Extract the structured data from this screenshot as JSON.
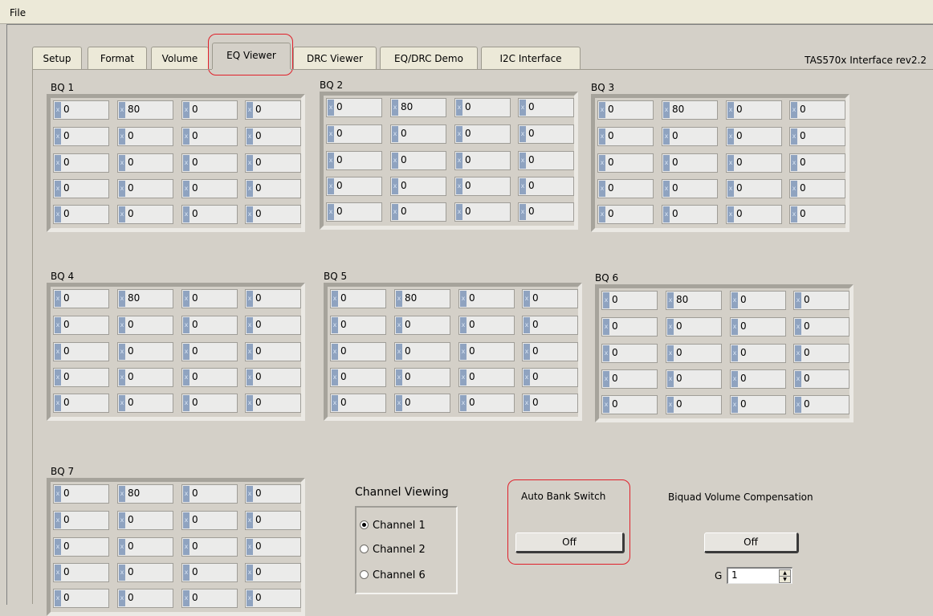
{
  "menu": {
    "file": "File"
  },
  "tabs": [
    {
      "label": "Setup"
    },
    {
      "label": "Format"
    },
    {
      "label": "Volume"
    },
    {
      "label": "EQ Viewer",
      "active": true
    },
    {
      "label": "DRC Viewer"
    },
    {
      "label": "EQ/DRC Demo"
    },
    {
      "label": "I2C Interface"
    }
  ],
  "revision": "TAS570x Interface rev2.2",
  "biquads": [
    {
      "label": "BQ 1",
      "rows": [
        [
          "0",
          "80",
          "0",
          "0"
        ],
        [
          "0",
          "0",
          "0",
          "0"
        ],
        [
          "0",
          "0",
          "0",
          "0"
        ],
        [
          "0",
          "0",
          "0",
          "0"
        ],
        [
          "0",
          "0",
          "0",
          "0"
        ]
      ]
    },
    {
      "label": "BQ 2",
      "rows": [
        [
          "0",
          "80",
          "0",
          "0"
        ],
        [
          "0",
          "0",
          "0",
          "0"
        ],
        [
          "0",
          "0",
          "0",
          "0"
        ],
        [
          "0",
          "0",
          "0",
          "0"
        ],
        [
          "0",
          "0",
          "0",
          "0"
        ]
      ]
    },
    {
      "label": "BQ 3",
      "rows": [
        [
          "0",
          "80",
          "0",
          "0"
        ],
        [
          "0",
          "0",
          "0",
          "0"
        ],
        [
          "0",
          "0",
          "0",
          "0"
        ],
        [
          "0",
          "0",
          "0",
          "0"
        ],
        [
          "0",
          "0",
          "0",
          "0"
        ]
      ]
    },
    {
      "label": "BQ 4",
      "rows": [
        [
          "0",
          "80",
          "0",
          "0"
        ],
        [
          "0",
          "0",
          "0",
          "0"
        ],
        [
          "0",
          "0",
          "0",
          "0"
        ],
        [
          "0",
          "0",
          "0",
          "0"
        ],
        [
          "0",
          "0",
          "0",
          "0"
        ]
      ]
    },
    {
      "label": "BQ 5",
      "rows": [
        [
          "0",
          "80",
          "0",
          "0"
        ],
        [
          "0",
          "0",
          "0",
          "0"
        ],
        [
          "0",
          "0",
          "0",
          "0"
        ],
        [
          "0",
          "0",
          "0",
          "0"
        ],
        [
          "0",
          "0",
          "0",
          "0"
        ]
      ]
    },
    {
      "label": "BQ 6",
      "rows": [
        [
          "0",
          "80",
          "0",
          "0"
        ],
        [
          "0",
          "0",
          "0",
          "0"
        ],
        [
          "0",
          "0",
          "0",
          "0"
        ],
        [
          "0",
          "0",
          "0",
          "0"
        ],
        [
          "0",
          "0",
          "0",
          "0"
        ]
      ]
    },
    {
      "label": "BQ 7",
      "rows": [
        [
          "0",
          "80",
          "0",
          "0"
        ],
        [
          "0",
          "0",
          "0",
          "0"
        ],
        [
          "0",
          "0",
          "0",
          "0"
        ],
        [
          "0",
          "0",
          "0",
          "0"
        ],
        [
          "0",
          "0",
          "0",
          "0"
        ]
      ]
    }
  ],
  "radix_marker": "x",
  "channel_viewing": {
    "title": "Channel Viewing",
    "options": [
      "Channel 1",
      "Channel 2",
      "Channel 6"
    ],
    "selected": "Channel 1"
  },
  "auto_bank_switch": {
    "label": "Auto Bank Switch",
    "state": "Off"
  },
  "biquad_volume_compensation": {
    "label": "Biquad Volume Compensation",
    "state": "Off"
  },
  "gain": {
    "label": "G",
    "value": "1"
  },
  "colors": {
    "highlight": "#e0202a",
    "radix": "#8fa3c0",
    "panel": "#d4d0c8"
  }
}
